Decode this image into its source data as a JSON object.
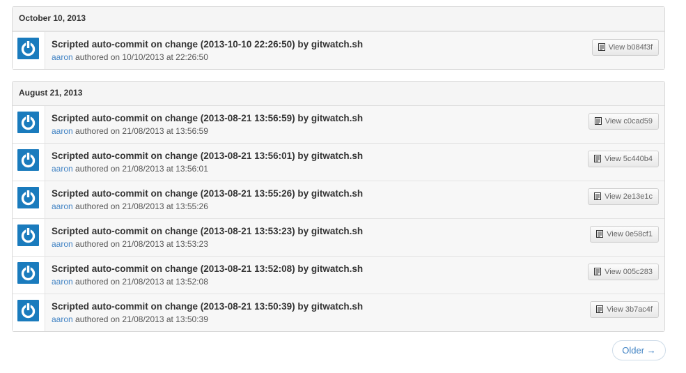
{
  "groups": [
    {
      "date": "October 10, 2013",
      "commits": [
        {
          "title": "Scripted auto-commit on change (2013-10-10 22:26:50) by gitwatch.sh",
          "author": "aaron",
          "authored": "authored on 10/10/2013 at 22:26:50",
          "view": "View b084f3f"
        }
      ]
    },
    {
      "date": "August 21, 2013",
      "commits": [
        {
          "title": "Scripted auto-commit on change (2013-08-21 13:56:59) by gitwatch.sh",
          "author": "aaron",
          "authored": "authored on 21/08/2013 at 13:56:59",
          "view": "View c0cad59"
        },
        {
          "title": "Scripted auto-commit on change (2013-08-21 13:56:01) by gitwatch.sh",
          "author": "aaron",
          "authored": "authored on 21/08/2013 at 13:56:01",
          "view": "View 5c440b4"
        },
        {
          "title": "Scripted auto-commit on change (2013-08-21 13:55:26) by gitwatch.sh",
          "author": "aaron",
          "authored": "authored on 21/08/2013 at 13:55:26",
          "view": "View 2e13e1c"
        },
        {
          "title": "Scripted auto-commit on change (2013-08-21 13:53:23) by gitwatch.sh",
          "author": "aaron",
          "authored": "authored on 21/08/2013 at 13:53:23",
          "view": "View 0e58cf1"
        },
        {
          "title": "Scripted auto-commit on change (2013-08-21 13:52:08) by gitwatch.sh",
          "author": "aaron",
          "authored": "authored on 21/08/2013 at 13:52:08",
          "view": "View 005c283"
        },
        {
          "title": "Scripted auto-commit on change (2013-08-21 13:50:39) by gitwatch.sh",
          "author": "aaron",
          "authored": "authored on 21/08/2013 at 13:50:39",
          "view": "View 3b7ac4f"
        }
      ]
    }
  ],
  "pagination": {
    "older_label": "Older →"
  },
  "icons": {
    "avatar": "power-icon",
    "view": "document-icon"
  },
  "colors": {
    "avatar_bg": "#1a7bbd",
    "link": "#4183c4"
  }
}
